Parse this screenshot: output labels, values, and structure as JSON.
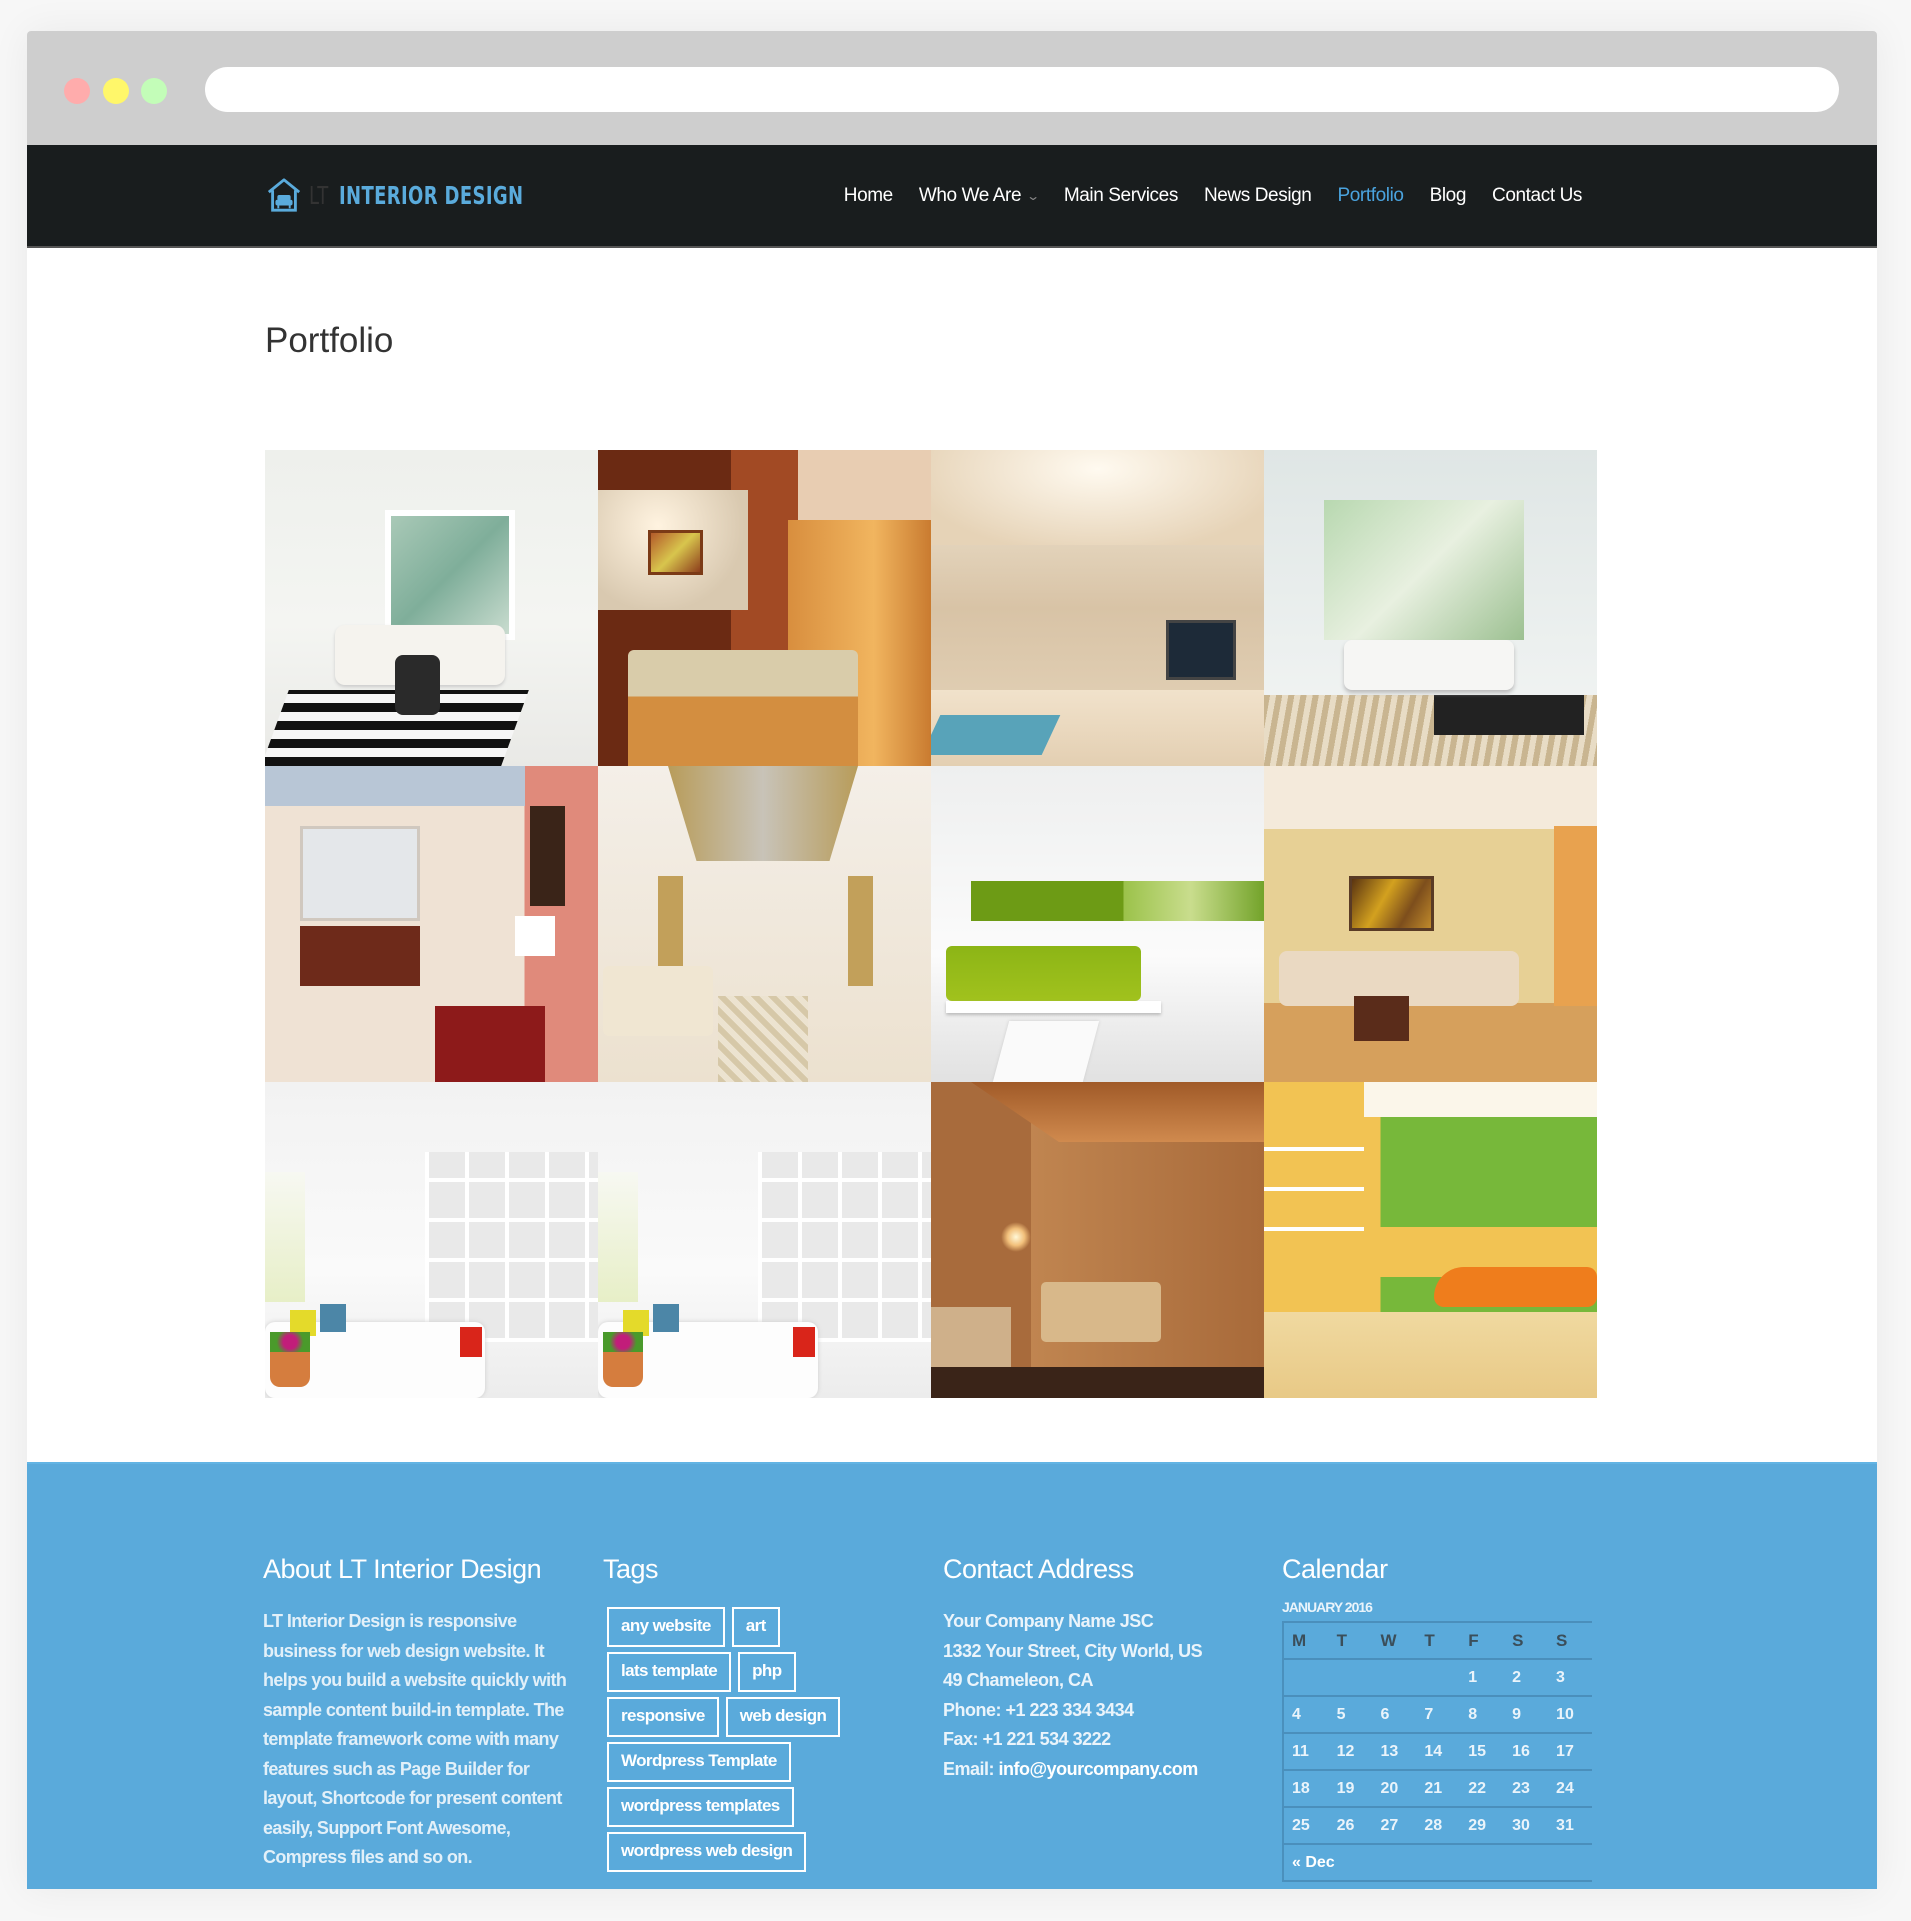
{
  "browser": {
    "window_controls": [
      "close",
      "minimize",
      "maximize"
    ],
    "url": ""
  },
  "header": {
    "logo_icon": "house-armchair-icon",
    "logo_prefix": "LT",
    "logo_name": "INTERIOR DESIGN",
    "nav": [
      {
        "label": "Home",
        "active": false
      },
      {
        "label": "Who We Are",
        "active": false,
        "has_dropdown": true
      },
      {
        "label": "Main Services",
        "active": false
      },
      {
        "label": "News Design",
        "active": false
      },
      {
        "label": "Portfolio",
        "active": true
      },
      {
        "label": "Blog",
        "active": false
      },
      {
        "label": "Contact Us",
        "active": false
      }
    ],
    "dropdown_icon": "chevron-down-icon"
  },
  "main": {
    "title": "Portfolio",
    "gallery": [
      {
        "alt": "White living room with striped rug"
      },
      {
        "alt": "Wood bedroom with wardrobe"
      },
      {
        "alt": "Modern living room with curved ceiling"
      },
      {
        "alt": "Bright living room with large windows"
      },
      {
        "alt": "Pink-walled room with staircase"
      },
      {
        "alt": "Long living room with gold ceiling"
      },
      {
        "alt": "White room with green sofa"
      },
      {
        "alt": "Beige living room with sectional sofa"
      },
      {
        "alt": "White room with shelves"
      },
      {
        "alt": "White room with shelves"
      },
      {
        "alt": "Wood paneled lounge"
      },
      {
        "alt": "Green and yellow room with orange sofa"
      }
    ]
  },
  "footer": {
    "about": {
      "heading": "About LT Interior Design",
      "text": "LT Interior Design is responsive business for web design website. It helps you build a website quickly with sample content build-in template. The template framework come with many features such as Page Builder for layout, Shortcode for present content easily, Support Font Awesome, Compress files and so on."
    },
    "tags": {
      "heading": "Tags",
      "items": [
        "any website",
        "art",
        "lats template",
        "php",
        "responsive",
        "web design",
        "Wordpress Template",
        "wordpress templates",
        "wordpress web design"
      ]
    },
    "contact": {
      "heading": "Contact Address",
      "company": "Your Company Name JSC",
      "street": "1332 Your Street, City World, US",
      "city": "49 Chameleon, CA",
      "phone": "Phone: +1 223 334 3434",
      "fax": "Fax: +1 221 534 3222",
      "email_label": "Email:",
      "email": "info@yourcompany.com"
    },
    "calendar": {
      "heading": "Calendar",
      "caption": "JANUARY 2016",
      "weekdays": [
        "M",
        "T",
        "W",
        "T",
        "F",
        "S",
        "S"
      ],
      "weeks": [
        [
          "",
          "",
          "",
          "",
          "1",
          "2",
          "3"
        ],
        [
          "4",
          "5",
          "6",
          "7",
          "8",
          "9",
          "10"
        ],
        [
          "11",
          "12",
          "13",
          "14",
          "15",
          "16",
          "17"
        ],
        [
          "18",
          "19",
          "20",
          "21",
          "22",
          "23",
          "24"
        ],
        [
          "25",
          "26",
          "27",
          "28",
          "29",
          "30",
          "31"
        ]
      ],
      "prev_link": "« Dec"
    }
  },
  "colors": {
    "nav_bg": "#191d1e",
    "accent": "#5aabdc",
    "active_nav": "#4aa3de",
    "footer_bg": "#5aaadb"
  }
}
